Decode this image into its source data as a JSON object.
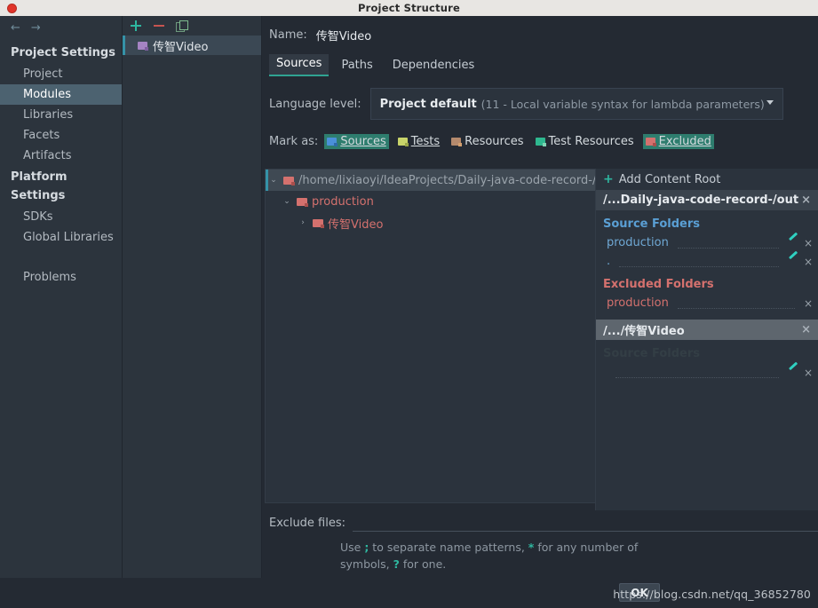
{
  "window": {
    "title": "Project Structure"
  },
  "sidebar": {
    "back_icon": "←",
    "forward_icon": "→",
    "groups": [
      {
        "label": "Project Settings",
        "items": [
          {
            "label": "Project",
            "selected": false
          },
          {
            "label": "Modules",
            "selected": true
          },
          {
            "label": "Libraries",
            "selected": false
          },
          {
            "label": "Facets",
            "selected": false
          },
          {
            "label": "Artifacts",
            "selected": false
          }
        ]
      },
      {
        "label": "Platform Settings",
        "items": [
          {
            "label": "SDKs",
            "selected": false
          },
          {
            "label": "Global Libraries",
            "selected": false
          }
        ]
      }
    ],
    "problems_label": "Problems",
    "help_icon": "?"
  },
  "modules_panel": {
    "toolbar": {
      "add_label": "+",
      "remove_label": "−",
      "copy_label": "copy"
    },
    "items": [
      {
        "label": "传智Video",
        "selected": true
      }
    ]
  },
  "main": {
    "name_label": "Name:",
    "name_value": "传智Video",
    "tabs": [
      {
        "label": "Sources",
        "active": true
      },
      {
        "label": "Paths",
        "active": false
      },
      {
        "label": "Dependencies",
        "active": false
      }
    ],
    "language_level": {
      "label": "Language level:",
      "value_main": "Project default",
      "value_sub": "(11 - Local variable syntax for lambda parameters)"
    },
    "mark_as": {
      "label": "Mark as:",
      "chips": [
        {
          "label": "Sources",
          "color": "#4a90d9",
          "selected": true
        },
        {
          "label": "Tests",
          "color": "#c8d46a",
          "selected": false
        },
        {
          "label": "Resources",
          "color": "#b58a6d",
          "selected": false
        },
        {
          "label": "Test Resources",
          "color": "#2eb88f",
          "selected": false
        },
        {
          "label": "Excluded",
          "color": "#d4716e",
          "selected": true
        }
      ]
    },
    "tree": [
      {
        "label": "/home/lixiaoyi/IdeaProjects/Daily-java-code-record-/out",
        "twisty": "⌄",
        "depth": 0,
        "style": "muted",
        "selected": true
      },
      {
        "label": "production",
        "twisty": "⌄",
        "depth": 1,
        "style": "red",
        "selected": false
      },
      {
        "label": "传智Video",
        "twisty": "›",
        "depth": 2,
        "style": "red",
        "selected": false
      }
    ],
    "exclude": {
      "label": "Exclude files:",
      "value": "",
      "hint_part1": "Use ",
      "hint_tok1": ";",
      "hint_part2": " to separate name patterns, ",
      "hint_tok2": "*",
      "hint_part3": " for any number of symbols, ",
      "hint_tok3": "?",
      "hint_part4": " for one."
    }
  },
  "info_panel": {
    "add_content_root": "Add Content Root",
    "add_icon": "+",
    "roots": [
      {
        "title": "/...Daily-java-code-record-/out",
        "close": "×",
        "sections": [
          {
            "title": "Source Folders",
            "kind": "source",
            "folders": [
              {
                "name": "production",
                "editable": true,
                "close": "×"
              },
              {
                "name": ".",
                "editable": true,
                "close": "×"
              }
            ]
          },
          {
            "title": "Excluded Folders",
            "kind": "excluded",
            "folders": [
              {
                "name": "production",
                "editable": false,
                "close": "×"
              }
            ]
          }
        ]
      },
      {
        "title": "/.../传智Video",
        "close": "×",
        "highlighted": true,
        "sections": [
          {
            "title": "Source Folders",
            "kind": "ghost",
            "folders": [
              {
                "name": "",
                "editable": true,
                "close": "×"
              }
            ]
          }
        ]
      }
    ]
  },
  "bottom": {
    "ok_label": "OK",
    "watermark": "https://blog.csdn.net/qq_36852780"
  }
}
